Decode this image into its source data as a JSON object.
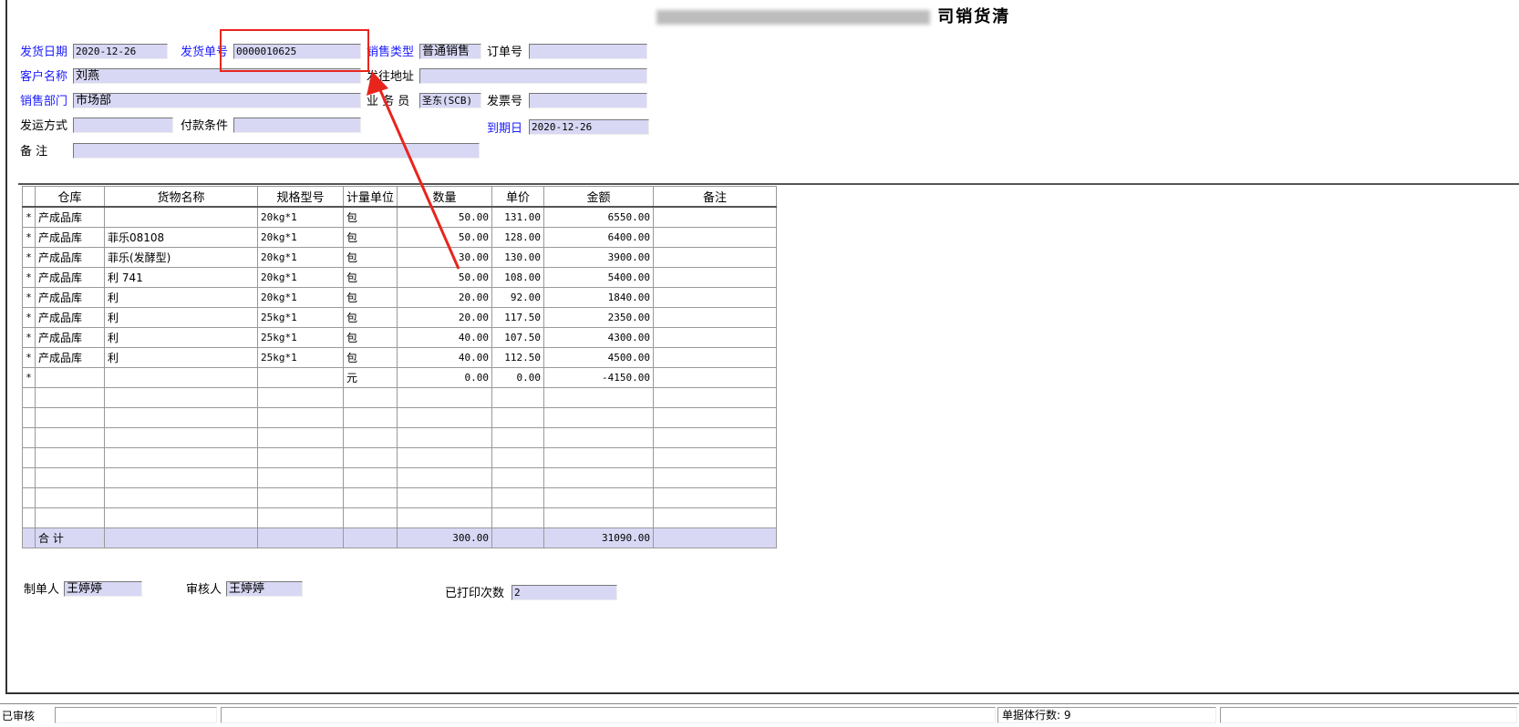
{
  "header": {
    "title_visible": "司销货清"
  },
  "form": {
    "ship_date": {
      "label": "发货日期",
      "value": "2020-12-26"
    },
    "ship_no": {
      "label": "发货单号",
      "value": "0000010625"
    },
    "sales_type": {
      "label": "销售类型",
      "value": "普通销售"
    },
    "order_no": {
      "label": "订单号",
      "value": ""
    },
    "customer": {
      "label": "客户名称",
      "value": "刘燕"
    },
    "ship_addr": {
      "label": "发往地址",
      "value": ""
    },
    "dept": {
      "label": "销售部门",
      "value": "市场部"
    },
    "salesman": {
      "label": "业 务 员",
      "value": "圣东(SCB)"
    },
    "invoice_no": {
      "label": "发票号",
      "value": ""
    },
    "ship_method": {
      "label": "发运方式",
      "value": ""
    },
    "pay_terms": {
      "label": "付款条件",
      "value": ""
    },
    "due_date": {
      "label": "到期日",
      "value": "2020-12-26"
    },
    "remark": {
      "label": "备    注",
      "value": ""
    }
  },
  "table": {
    "columns": [
      "仓库",
      "货物名称",
      "规格型号",
      "计量单位",
      "数量",
      "单价",
      "金额",
      "备注"
    ],
    "rows": [
      {
        "mark": "*",
        "wh": "产成品库",
        "name": "",
        "spec": "20kg*1",
        "unit": "包",
        "qty": "50.00",
        "price": "131.00",
        "amount": "6550.00",
        "note": ""
      },
      {
        "mark": "*",
        "wh": "产成品库",
        "name": "菲乐08108",
        "spec": "20kg*1",
        "unit": "包",
        "qty": "50.00",
        "price": "128.00",
        "amount": "6400.00",
        "note": ""
      },
      {
        "mark": "*",
        "wh": "产成品库",
        "name": "菲乐(发酵型)",
        "spec": "20kg*1",
        "unit": "包",
        "qty": "30.00",
        "price": "130.00",
        "amount": "3900.00",
        "note": ""
      },
      {
        "mark": "*",
        "wh": "产成品库",
        "name": "利 741",
        "spec": "20kg*1",
        "unit": "包",
        "qty": "50.00",
        "price": "108.00",
        "amount": "5400.00",
        "note": ""
      },
      {
        "mark": "*",
        "wh": "产成品库",
        "name": "利",
        "spec": "20kg*1",
        "unit": "包",
        "qty": "20.00",
        "price": "92.00",
        "amount": "1840.00",
        "note": ""
      },
      {
        "mark": "*",
        "wh": "产成品库",
        "name": "利",
        "spec": "25kg*1",
        "unit": "包",
        "qty": "20.00",
        "price": "117.50",
        "amount": "2350.00",
        "note": ""
      },
      {
        "mark": "*",
        "wh": "产成品库",
        "name": "利",
        "spec": "25kg*1",
        "unit": "包",
        "qty": "40.00",
        "price": "107.50",
        "amount": "4300.00",
        "note": ""
      },
      {
        "mark": "*",
        "wh": "产成品库",
        "name": "利",
        "spec": "25kg*1",
        "unit": "包",
        "qty": "40.00",
        "price": "112.50",
        "amount": "4500.00",
        "note": ""
      },
      {
        "mark": "*",
        "wh": "",
        "name": "",
        "spec": "",
        "unit": "元",
        "qty": "0.00",
        "price": "0.00",
        "amount": "-4150.00",
        "note": ""
      }
    ],
    "empty_rows": 7,
    "total": {
      "label": "合  计",
      "qty": "300.00",
      "amount": "31090.00"
    }
  },
  "footer": {
    "maker": {
      "label": "制单人",
      "value": "王婷婷"
    },
    "checker": {
      "label": "审核人",
      "value": "王婷婷"
    },
    "print_count": {
      "label": "已打印次数",
      "value": "2"
    }
  },
  "status": {
    "state": "已审核",
    "rows_info": "单据体行数: 9"
  },
  "colors": {
    "field_bg": "#d8d8f5",
    "label_blue": "#1a1aff",
    "highlight_red": "#e8251d"
  }
}
